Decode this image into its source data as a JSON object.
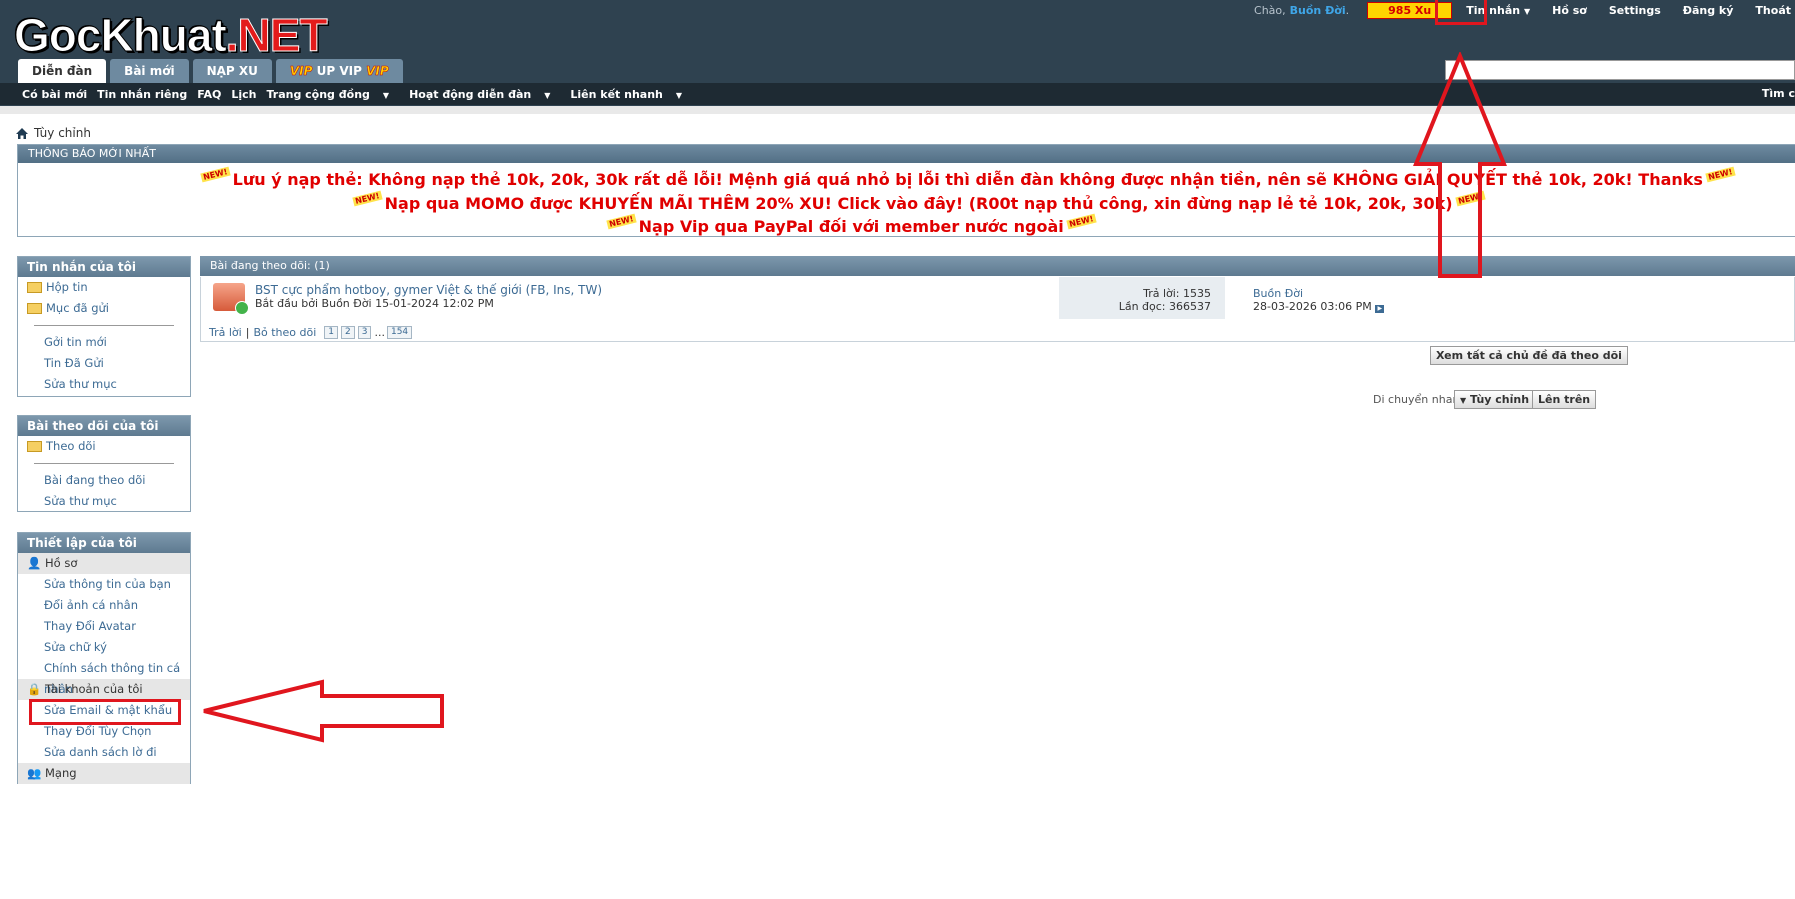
{
  "header": {
    "logo_white": "GocKhuat",
    "logo_red": ".NET",
    "greeting": "Chào,",
    "username": "Buồn Đời",
    "sep": ".",
    "xu": "985 Xu",
    "links": [
      "Tin nhắn",
      "Hồ sơ",
      "Settings",
      "Đăng ký",
      "Thoát"
    ],
    "tabs": [
      "Diễn đàn",
      "Bài mới",
      "NẠP XU"
    ],
    "vip_tab": {
      "vip1": "VIP",
      "text": " UP VIP ",
      "vip2": "VIP"
    },
    "subnav": [
      "Có bài mới",
      "Tin nhắn riêng",
      "FAQ",
      "Lịch",
      "Trang cộng đồng",
      "Hoạt động diễn đàn",
      "Liên kết nhanh"
    ],
    "tim_label": "Tìm c"
  },
  "breadcrumb": "Tùy chỉnh",
  "notice": {
    "title": "THÔNG BÁO MỚI NHẤT",
    "new_badge": "NEW!",
    "lines": [
      "Lưu ý nạp thẻ: Không nạp thẻ 10k, 20k, 30k rất dễ lỗi! Mệnh giá quá nhỏ bị lỗi thì diễn đàn không được nhận tiền, nên sẽ KHÔNG GIẢI QUYẾT thẻ 10k, 20k! Thanks",
      "Nạp qua MOMO được KHUYẾN MÃI THÊM 20% XU! Click vào đây! (R00t nạp thủ công, xin đừng nạp lẻ tẻ 10k, 20k, 30k)",
      "Nạp Vip qua PayPal đối với member nước ngoài"
    ]
  },
  "sidebar": {
    "messages": {
      "title": "Tin nhắn của tôi",
      "folders": [
        "Hộp tin",
        "Mục đã gửi"
      ],
      "items": [
        "Gởi tin mới",
        "Tin Đã Gửi",
        "Sửa thư mục"
      ]
    },
    "subscriptions": {
      "title": "Bài theo dõi của tôi",
      "folders": [
        "Theo dõi"
      ],
      "items": [
        "Bài đang theo dõi",
        "Sửa thư mục"
      ]
    },
    "settings": {
      "title": "Thiết lập của tôi",
      "cat_profile": "Hồ sơ",
      "profile_items": [
        "Sửa thông tin của bạn",
        "Đổi ảnh cá nhân",
        "Thay Đổi Avatar",
        "Sửa chữ ký",
        "Chính sách thông tin cá nhân"
      ],
      "cat_account": "Tài khoản của tôi",
      "account_items": [
        "Sửa Email & mật khẩu",
        "Thay Đổi Tùy Chọn",
        "Sửa danh sách lờ đi"
      ],
      "cat_network": "Mạng"
    }
  },
  "main": {
    "head": "Bài đang theo dõi: (1)",
    "thread": {
      "title": "BST cực phẩm hotboy, gymer Việt & thế giới (FB, Ins, TW)",
      "started": "Bắt đầu bởi Buồn Đời 15-01-2024 12:02 PM",
      "replies": "Trả lời: 1535",
      "views": "Lần đọc: 366537",
      "last_user": "Buồn Đời",
      "last_time": "28-03-2026 03:06 PM",
      "reply": "Trả lời",
      "divider": "|",
      "unsubscribe": "Bỏ theo dõi",
      "pages": [
        "1",
        "2",
        "3"
      ],
      "ellipsis": "...",
      "last_page": "154"
    },
    "view_all": "Xem tất cả chủ đề đã theo dõi",
    "quick_nav": "Di chuyển nhanh",
    "quick_select": "Tùy chỉnh",
    "top": "Lên trên"
  }
}
